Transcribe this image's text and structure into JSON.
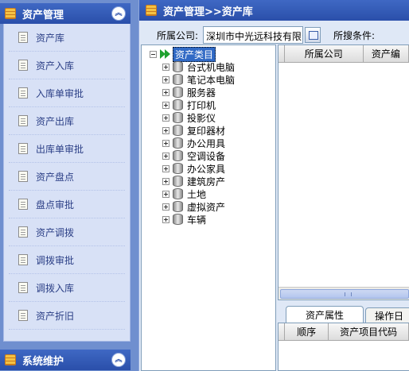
{
  "sidebar": {
    "header_title": "资产管理",
    "items": [
      {
        "label": "资产库"
      },
      {
        "label": "资产入库"
      },
      {
        "label": "入库单审批"
      },
      {
        "label": "资产出库"
      },
      {
        "label": "出库单审批"
      },
      {
        "label": "资产盘点"
      },
      {
        "label": "盘点审批"
      },
      {
        "label": "资产调拨"
      },
      {
        "label": "调拨审批"
      },
      {
        "label": "调拨入库"
      },
      {
        "label": "资产折旧"
      }
    ],
    "footer_title": "系统维护"
  },
  "main": {
    "breadcrumb": "资产管理>>资产库",
    "company_label": "所属公司:",
    "company_value": "深圳市中光远科技有限公司",
    "search_label": "所搜条件:",
    "tree": {
      "root": "资产类目",
      "children": [
        "台式机电脑",
        "笔记本电脑",
        "服务器",
        "打印机",
        "投影仪",
        "复印器材",
        "办公用具",
        "空调设备",
        "办公家具",
        "建筑房产",
        "土地",
        "虚拟资产",
        "车辆"
      ]
    },
    "grid_columns": [
      "所属公司",
      "资产编"
    ],
    "tabs": [
      "资产属性",
      "操作日"
    ],
    "detail_columns": [
      "顺序",
      "资产项目代码"
    ]
  }
}
